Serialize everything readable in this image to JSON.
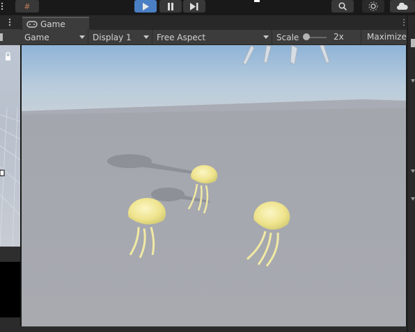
{
  "toolbar": {
    "grid_label": "#",
    "icons": [
      "play-icon",
      "pause-icon",
      "step-icon",
      "search-icon",
      "settings-icon",
      "cloud-icon"
    ]
  },
  "game_tab": {
    "label": "Game",
    "menu": "⋮"
  },
  "game_toolbar": {
    "view_dropdown": "Game",
    "display_dropdown": "Display 1",
    "aspect_dropdown": "Free Aspect",
    "scale_label": "Scale",
    "scale_value": "2x",
    "maximize_label": "Maximize"
  },
  "colors": {
    "play_active": "#4a7fc4",
    "jellyfish": "#f2ea9a",
    "ground": "#a3a5ad"
  }
}
